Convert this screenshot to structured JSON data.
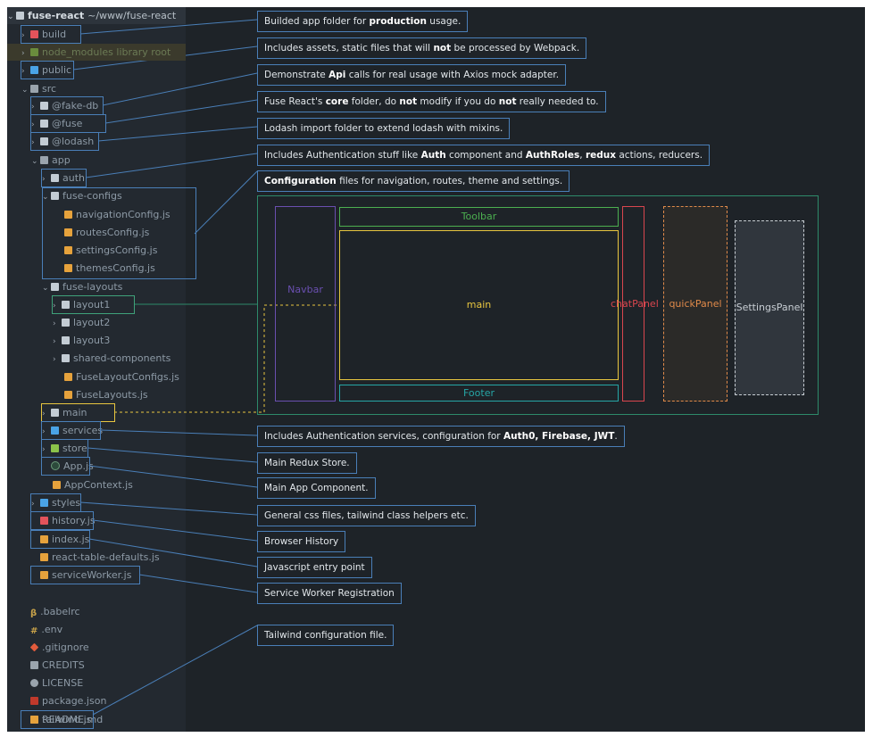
{
  "tree": {
    "root_label": "fuse-react",
    "root_path": "~/www/fuse-react",
    "items": {
      "build": "build",
      "node_modules": "node_modules  library root",
      "public": "public",
      "src": "src",
      "fake_db": "@fake-db",
      "fuse": "@fuse",
      "lodash": "@lodash",
      "app": "app",
      "auth": "auth",
      "fuse_configs": "fuse-configs",
      "navigationConfig": "navigationConfig.js",
      "routesConfig": "routesConfig.js",
      "settingsConfig": "settingsConfig.js",
      "themesConfig": "themesConfig.js",
      "fuse_layouts": "fuse-layouts",
      "layout1": "layout1",
      "layout2": "layout2",
      "layout3": "layout3",
      "shared_components": "shared-components",
      "FuseLayoutConfigs": "FuseLayoutConfigs.js",
      "FuseLayouts": "FuseLayouts.js",
      "main": "main",
      "services": "services",
      "store": "store",
      "App": "App.js",
      "AppContext": "AppContext.js",
      "styles": "styles",
      "history": "history.js",
      "index": "index.js",
      "react_table_defaults": "react-table-defaults.js",
      "serviceWorker": "serviceWorker.js",
      "babelrc": ".babelrc",
      "env": ".env",
      "gitignore": ".gitignore",
      "credits": "CREDITS",
      "license": "LICENSE",
      "package": "package.json",
      "readme": "README.md",
      "tailwind": "tailwind.js"
    }
  },
  "annotations": {
    "build": [
      "Builded app folder for ",
      "production",
      " usage."
    ],
    "public": [
      "Includes assets, static files that will ",
      "not",
      " be processed by Webpack."
    ],
    "fake_db": [
      "Demonstrate ",
      "Api",
      " calls for real usage with Axios mock adapter."
    ],
    "fuse": [
      "Fuse React's ",
      "core",
      " folder, do ",
      "not",
      " modify if you do ",
      "not",
      " really needed to."
    ],
    "lodash": [
      "Lodash import folder to extend lodash with mixins."
    ],
    "auth": [
      "Includes Authentication stuff like ",
      "Auth",
      " component and ",
      "AuthRoles",
      ", ",
      "redux",
      " actions, reducers."
    ],
    "configs": [
      "Configuration",
      " files for navigation, routes, theme and settings."
    ],
    "services": [
      "Includes Authentication services, configuration for ",
      "Auth0, Firebase, JWT",
      "."
    ],
    "store": [
      "Main Redux Store."
    ],
    "app": [
      "Main App Component."
    ],
    "styles": [
      "General css files, tailwind class helpers etc."
    ],
    "history": [
      "Browser History"
    ],
    "index": [
      "Javascript entry point"
    ],
    "serviceWorker": [
      "Service Worker Registration"
    ],
    "tailwind": [
      "Tailwind configuration file."
    ]
  },
  "layout_labels": {
    "navbar": "Navbar",
    "toolbar": "Toolbar",
    "main": "main",
    "footer": "Footer",
    "chatPanel": "chatPanel",
    "quickPanel": "quickPanel",
    "settingsPanel": "SettingsPanel"
  },
  "colors": {
    "annotation_border": "#4a7fb8",
    "navbar": "#6a4fb0",
    "toolbar": "#4caf50",
    "main": "#e8c640",
    "footer": "#26a6a6",
    "chatPanel": "#d9464e",
    "quickPanel": "#e08a4a",
    "settingsPanel": "#c7cdd3",
    "layout_frame": "#2e8a6a"
  }
}
